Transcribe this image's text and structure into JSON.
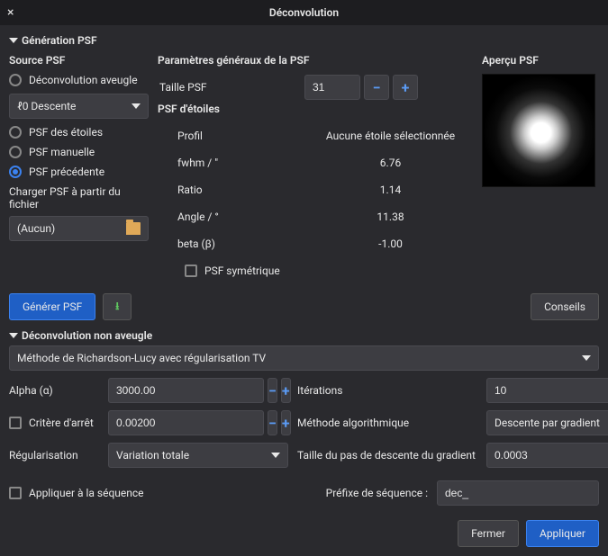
{
  "title": "Déconvolution",
  "psf_gen": {
    "header": "Génération PSF",
    "source_label": "Source PSF",
    "blind": "Déconvolution aveugle",
    "descent_select": "ℓ0 Descente",
    "stars": "PSF des étoiles",
    "manual": "PSF manuelle",
    "previous": "PSF précédente",
    "load_label": "Charger PSF à partir du fichier",
    "file_none": "(Aucun)",
    "generate_btn": "Générer PSF",
    "params_header": "Paramètres généraux de la PSF",
    "taille_label": "Taille PSF",
    "taille_value": "31",
    "stars_header": "PSF d'étoiles",
    "profil_label": "Profil",
    "profil_value": "Aucune étoile sélectionnée",
    "fwhm_label": "fwhm / \"",
    "fwhm_value": "6.76",
    "ratio_label": "Ratio",
    "ratio_value": "1.14",
    "angle_label": "Angle / °",
    "angle_value": "11.38",
    "beta_label": "beta (β)",
    "beta_value": "-1.00",
    "sym_label": "PSF symétrique",
    "preview_label": "Aperçu PSF",
    "tips_btn": "Conseils"
  },
  "nonblind": {
    "header": "Déconvolution non aveugle",
    "method": "Méthode de Richardson-Lucy avec régularisation TV",
    "alpha_label": "Alpha (α)",
    "alpha_value": "3000.00",
    "iter_label": "Itérations",
    "iter_value": "10",
    "stop_label": "Critère d'arrêt",
    "stop_value": "0.00200",
    "algo_label": "Méthode algorithmique",
    "algo_value": "Descente par gradient",
    "reg_label": "Régularisation",
    "reg_value": "Variation totale",
    "step_label": "Taille du pas de descente du gradient",
    "step_value": "0.0003"
  },
  "seq": {
    "apply_label": "Appliquer à la séquence",
    "prefix_label": "Préfixe de séquence :",
    "prefix_value": "dec_"
  },
  "footer": {
    "close": "Fermer",
    "apply": "Appliquer"
  }
}
